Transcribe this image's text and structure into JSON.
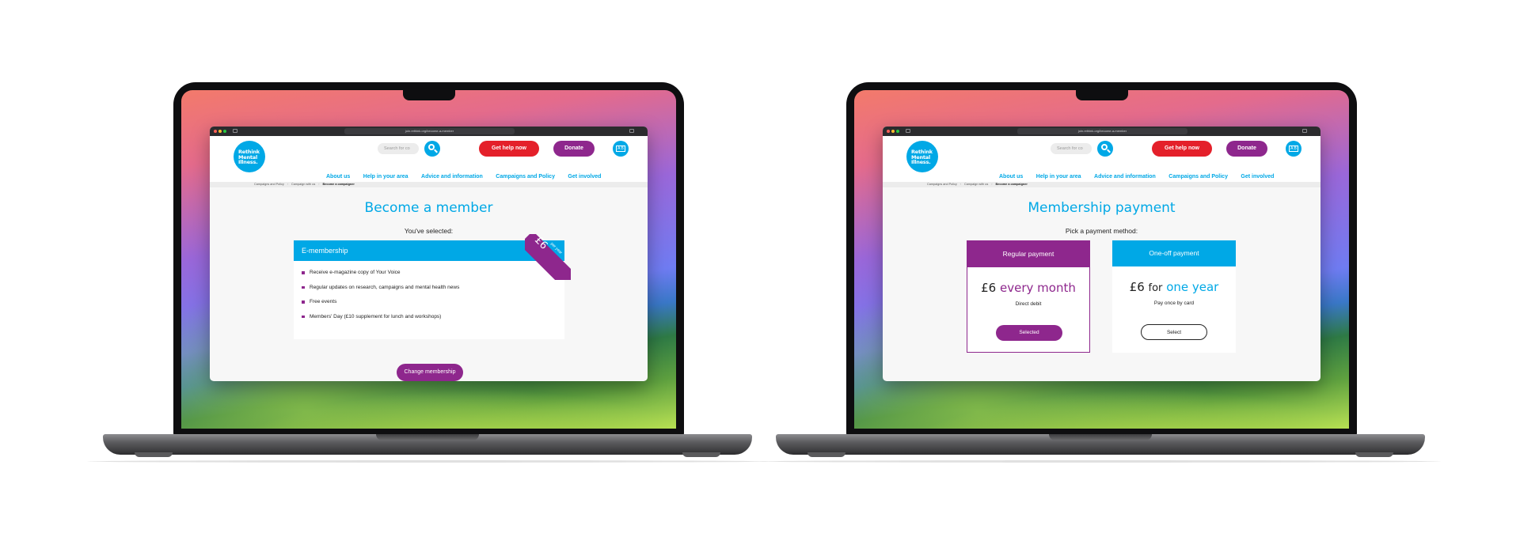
{
  "browser": {
    "url": "join.rethink.org/become-a-member"
  },
  "site": {
    "logo_text": [
      "Rethink",
      "Mental",
      "Illness."
    ],
    "search_placeholder": "Search for co",
    "help_label": "Get help now",
    "donate_label": "Donate",
    "accessibility_label": "A B",
    "nav": [
      "About us",
      "Help in your area",
      "Advice and information",
      "Campaigns and Policy",
      "Get involved"
    ],
    "breadcrumb": [
      "Campaigns and Policy",
      "Campaign with us",
      "Become a campaigner"
    ]
  },
  "member_page": {
    "title": "Become a member",
    "subtitle": "You've selected:",
    "card_title": "E-membership",
    "ribbon_price": "£6",
    "ribbon_per": "per year",
    "benefits": [
      "Receive e-magazine copy of Your Voice",
      "Regular updates on research, campaigns and mental health news",
      "Free events",
      "Members' Day (£10 supplement for lunch and workshops)"
    ],
    "change_label": "Change membership"
  },
  "payment_page": {
    "title": "Membership payment",
    "subtitle": "Pick a payment method:",
    "regular": {
      "title": "Regular payment",
      "price": "£6",
      "period": "every month",
      "note": "Direct debit",
      "button": "Selected"
    },
    "oneoff": {
      "title": "One-off payment",
      "price": "£6",
      "connector": "for",
      "period": "one year",
      "note": "Pay once by card",
      "button": "Select"
    }
  },
  "colors": {
    "brand_blue": "#00a8e6",
    "brand_purple": "#8e278d",
    "help_red": "#e4202a"
  }
}
